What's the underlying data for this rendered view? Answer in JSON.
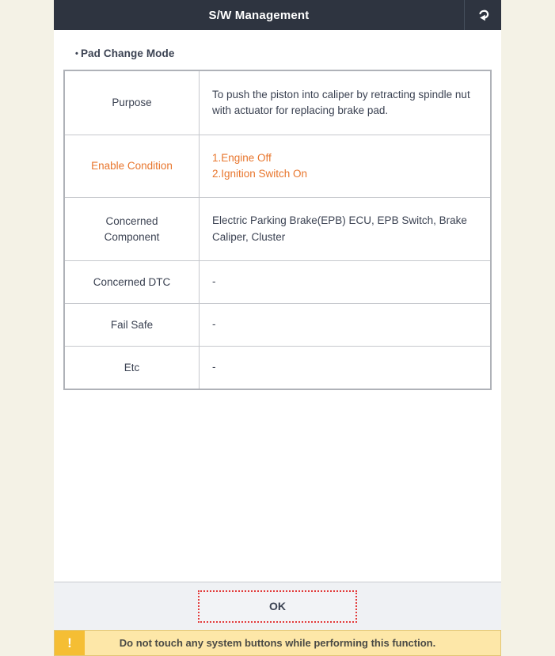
{
  "header": {
    "title": "S/W Management",
    "back_icon": "return-arrow-icon"
  },
  "section": {
    "bullet": "•",
    "title": "Pad Change Mode"
  },
  "table": {
    "rows": [
      {
        "label": "Purpose",
        "lines": [
          "To push the piston into caliper by retracting spindle nut with actuator for replacing brake pad."
        ]
      },
      {
        "label": "Enable Condition",
        "lines": [
          "1.Engine Off",
          "2.Ignition Switch On"
        ]
      },
      {
        "label": "Concerned Component",
        "label_line1": "Concerned",
        "label_line2": "Component",
        "lines": [
          "Electric Parking Brake(EPB) ECU, EPB Switch, Brake Caliper, Cluster"
        ]
      },
      {
        "label": "Concerned DTC",
        "lines": [
          "-"
        ]
      },
      {
        "label": "Fail Safe",
        "lines": [
          "-"
        ]
      },
      {
        "label": "Etc",
        "lines": [
          "-"
        ]
      }
    ]
  },
  "footer": {
    "ok_label": "OK"
  },
  "warning": {
    "icon": "!",
    "icon_name": "exclamation-icon",
    "text": "Do not touch any system buttons while performing this function."
  },
  "colors": {
    "header_bg": "#2E3440",
    "accent_orange": "#E8762D",
    "focus_red": "#E23B3B",
    "warning_bg": "#FDE7A8",
    "warning_icon_bg": "#F5BE34",
    "page_bg": "#F4F2E6"
  }
}
